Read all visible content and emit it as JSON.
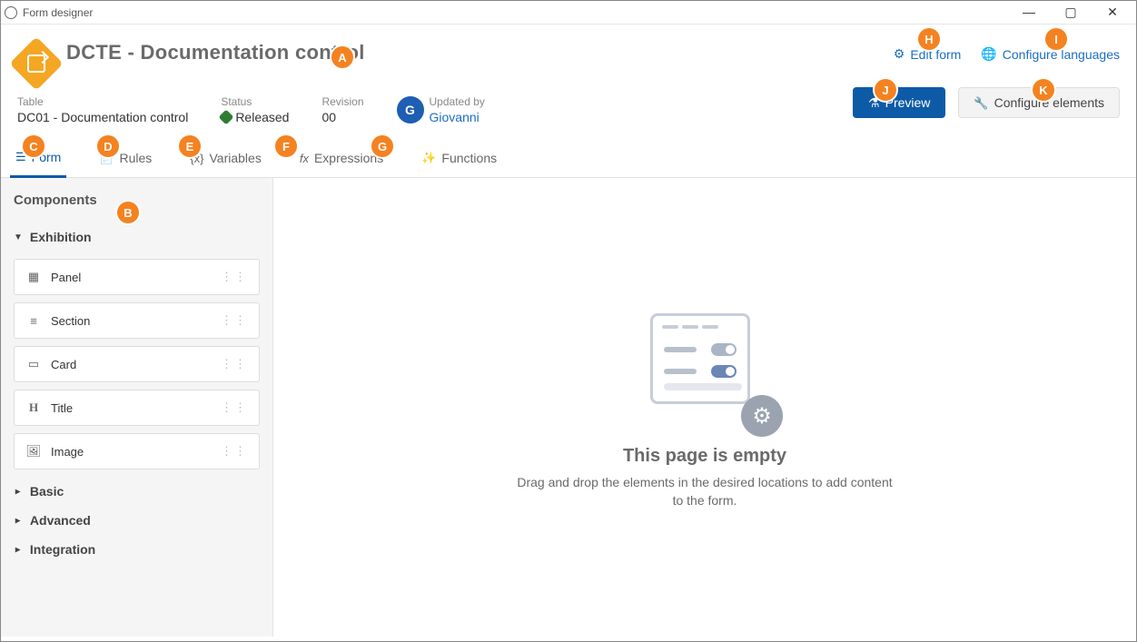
{
  "window": {
    "title": "Form designer"
  },
  "header": {
    "title": "DCTE - Documentation control",
    "edit_form": "Edit form",
    "configure_languages": "Configure languages"
  },
  "meta": {
    "table_label": "Table",
    "table_value": "DC01 - Documentation control",
    "status_label": "Status",
    "status_value": "Released",
    "revision_label": "Revision",
    "revision_value": "00",
    "updated_by_label": "Updated by",
    "updated_by_value": "Giovanni",
    "updated_by_initial": "G"
  },
  "actions": {
    "preview": "Preview",
    "configure_elements": "Configure elements"
  },
  "tabs": {
    "form": "Form",
    "rules": "Rules",
    "variables": "Variables",
    "expressions": "Expressions",
    "functions": "Functions"
  },
  "sidebar": {
    "title": "Components",
    "groups": {
      "exhibition": "Exhibition",
      "basic": "Basic",
      "advanced": "Advanced",
      "integration": "Integration"
    },
    "exhibition_items": {
      "panel": "Panel",
      "section": "Section",
      "card": "Card",
      "title": "Title",
      "image": "Image"
    }
  },
  "canvas": {
    "empty_title": "This page is empty",
    "empty_sub": "Drag and drop the elements in the desired locations to add content to the form."
  },
  "annotations": {
    "A": "A",
    "B": "B",
    "C": "C",
    "D": "D",
    "E": "E",
    "F": "F",
    "G": "G",
    "H": "H",
    "I": "I",
    "J": "J",
    "K": "K"
  }
}
